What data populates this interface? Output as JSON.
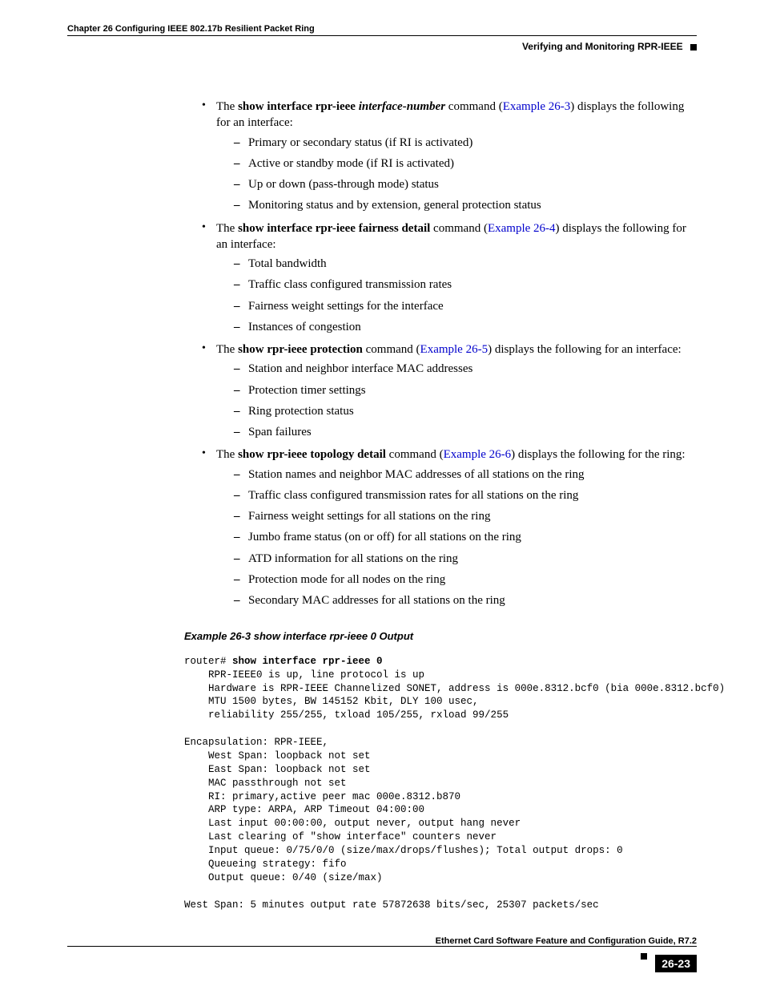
{
  "header": {
    "left": "Chapter 26 Configuring IEEE 802.17b Resilient Packet Ring",
    "right": "Verifying and Monitoring RPR-IEEE"
  },
  "list1": {
    "intro_pre": "The ",
    "intro_cmd": "show interface rpr-ieee",
    "intro_arg": "interface-number",
    "intro_mid": " command (",
    "intro_link": "Example 26-3",
    "intro_post": ") displays the following for an interface:",
    "sub": [
      "Primary or secondary status (if RI is activated)",
      "Active or standby mode (if RI is activated)",
      "Up or down (pass-through mode) status",
      "Monitoring status and by extension, general protection status"
    ]
  },
  "list2": {
    "intro_pre": "The ",
    "intro_cmd": "show interface rpr-ieee fairness detail",
    "intro_mid": " command (",
    "intro_link": "Example 26-4",
    "intro_post": ") displays the following for an interface:",
    "sub": [
      "Total bandwidth",
      "Traffic class configured transmission rates",
      "Fairness weight settings for the interface",
      "Instances of congestion"
    ]
  },
  "list3": {
    "intro_pre": "The ",
    "intro_cmd": "show rpr-ieee protection",
    "intro_mid": " command (",
    "intro_link": "Example 26-5",
    "intro_post": ") displays the following for an interface:",
    "sub": [
      "Station and neighbor interface MAC addresses",
      "Protection timer settings",
      "Ring protection status",
      "Span failures"
    ]
  },
  "list4": {
    "intro_pre": "The ",
    "intro_cmd": "show rpr-ieee topology detail",
    "intro_mid": " command (",
    "intro_link": "Example 26-6",
    "intro_post": ") displays the following for the ring:",
    "sub": [
      "Station names and neighbor MAC addresses of all stations on the ring",
      "Traffic class configured transmission rates for all stations on the ring",
      "Fairness weight settings for all stations on the ring",
      "Jumbo frame status (on or off) for all stations on the ring",
      "ATD information for all stations on the ring",
      "Protection mode for all nodes on the ring",
      "Secondary MAC addresses for all stations on the ring"
    ]
  },
  "example": {
    "title": "Example 26-3   show interface rpr-ieee 0 Output",
    "prompt": "router# ",
    "cmd": "show interface rpr-ieee 0",
    "body": "    RPR-IEEE0 is up, line protocol is up \n    Hardware is RPR-IEEE Channelized SONET, address is 000e.8312.bcf0 (bia 000e.8312.bcf0) \n    MTU 1500 bytes, BW 145152 Kbit, DLY 100 usec, \n    reliability 255/255, txload 105/255, rxload 99/255\n\nEncapsulation: RPR-IEEE,\n    West Span: loopback not set\n    East Span: loopback not set\n    MAC passthrough not set \n    RI: primary,active peer mac 000e.8312.b870 \n    ARP type: ARPA, ARP Timeout 04:00:00\n    Last input 00:00:00, output never, output hang never\n    Last clearing of \"show interface\" counters never\n    Input queue: 0/75/0/0 (size/max/drops/flushes); Total output drops: 0\n    Queueing strategy: fifo\n    Output queue: 0/40 (size/max)\n\nWest Span: 5 minutes output rate 57872638 bits/sec, 25307 packets/sec"
  },
  "footer": {
    "title": "Ethernet Card Software Feature and Configuration Guide, R7.2",
    "pagenum": "26-23"
  }
}
